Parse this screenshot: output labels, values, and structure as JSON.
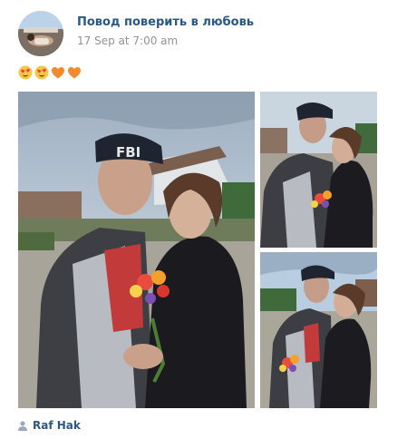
{
  "post": {
    "author": "Повод поверить в любовь",
    "time": "17 Sep at 7:00 am",
    "emojis": [
      "heart-eyes-emoji",
      "heart-eyes-emoji",
      "orange-heart-emoji",
      "orange-heart-emoji"
    ],
    "signer": "Raf Hak",
    "photos": [
      {
        "name": "couple-photo-main",
        "cap_text": "FBI"
      },
      {
        "name": "couple-photo-hug"
      },
      {
        "name": "couple-photo-kiss"
      }
    ]
  },
  "colors": {
    "link": "#2a5885",
    "meta": "#939393"
  }
}
